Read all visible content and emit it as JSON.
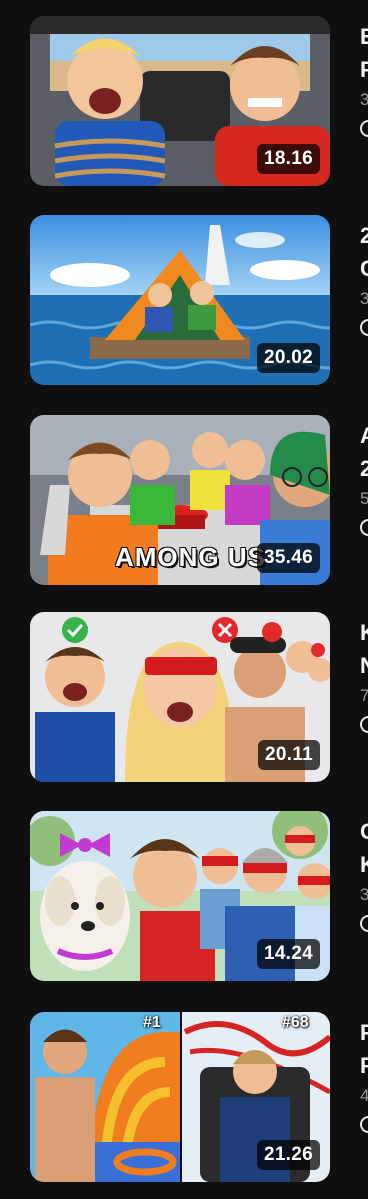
{
  "videos": [
    {
      "duration": "18.16",
      "title_line1": "E",
      "title_line2": "P",
      "sub": "3"
    },
    {
      "duration": "20.02",
      "title_line1": "2",
      "title_line2": "C",
      "sub": "3"
    },
    {
      "duration": "35.46",
      "title_line1": "A",
      "title_line2": "2",
      "sub": "5",
      "overlay_text": "AMONG US"
    },
    {
      "duration": "20.11",
      "title_line1": "K",
      "title_line2": "N",
      "sub": "7"
    },
    {
      "duration": "14.24",
      "title_line1": "C",
      "title_line2": "K",
      "sub": "3"
    },
    {
      "duration": "21.26",
      "title_line1": "F",
      "title_line2": "F",
      "sub": "4",
      "rank_left": "#1",
      "rank_right": "#68"
    }
  ]
}
